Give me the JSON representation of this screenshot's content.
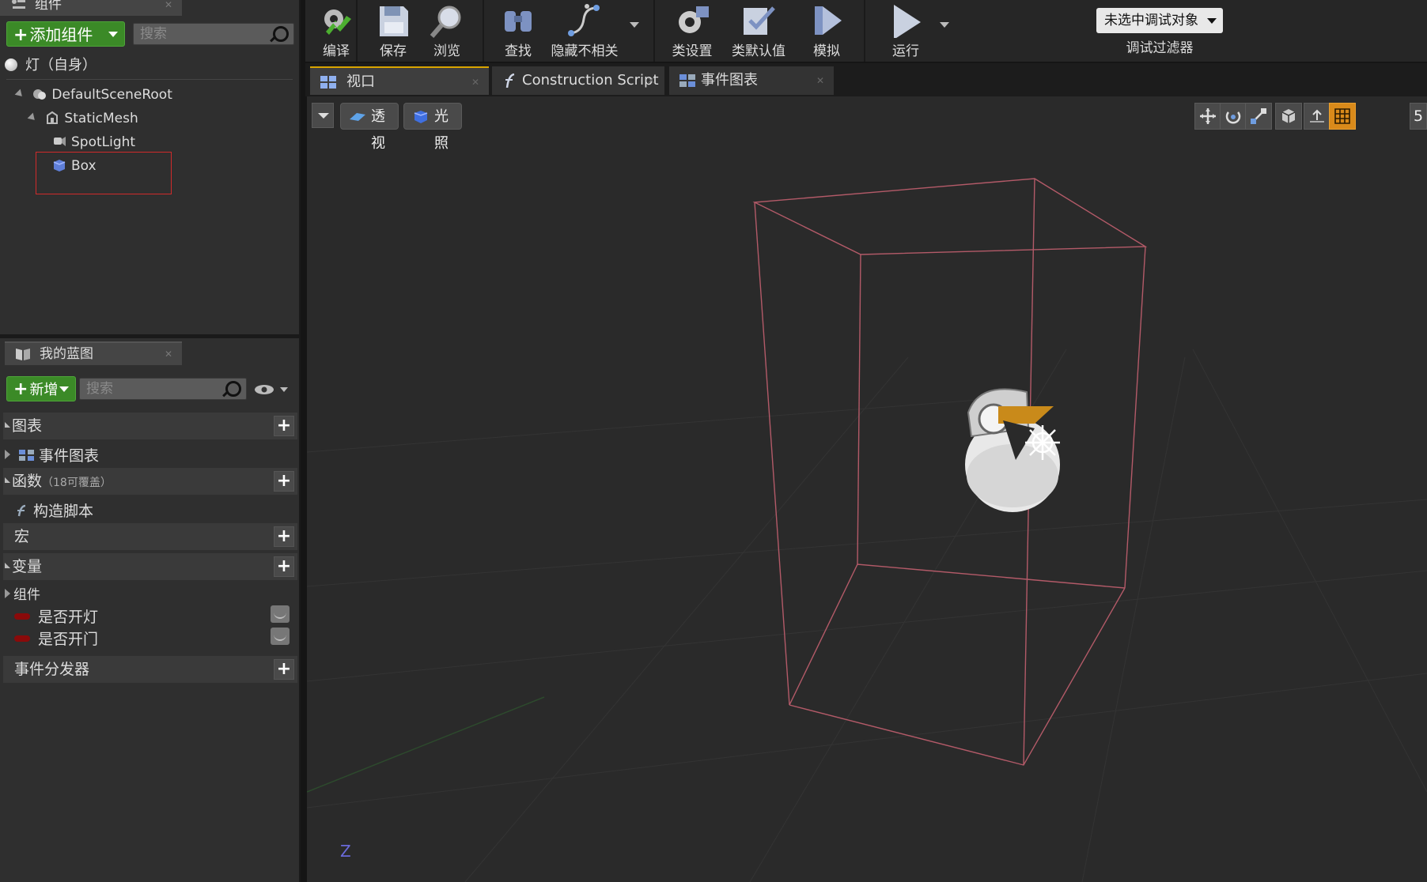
{
  "components_panel": {
    "tab_label": "组件",
    "add_button": "添加组件",
    "search_placeholder": "搜索",
    "self_item": "灯（自身）",
    "tree": [
      {
        "label": "DefaultSceneRoot",
        "icon": "scene-root-icon"
      },
      {
        "label": "StaticMesh",
        "icon": "static-mesh-icon"
      },
      {
        "label": "SpotLight",
        "icon": "spotlight-icon"
      },
      {
        "label": "Box",
        "icon": "box-icon"
      }
    ],
    "highlight_color": "#d02a2a"
  },
  "my_blueprint": {
    "tab_label": "我的蓝图",
    "new_button": "新增",
    "search_placeholder": "搜索",
    "sections": {
      "graphs": "图表",
      "event_graph": "事件图表",
      "functions": "函数",
      "functions_note": "（18可覆盖）",
      "construction_script": "构造脚本",
      "macros": "宏",
      "variables": "变量",
      "components": "组件",
      "var1": "是否开灯",
      "var2": "是否开门",
      "event_dispatchers": "事件分发器"
    },
    "variable_color": "#8a0a0a"
  },
  "toolbar": {
    "compile": "编译",
    "save": "保存",
    "browse": "浏览",
    "find": "查找",
    "hide_unrelated": "隐藏不相关",
    "class_settings": "类设置",
    "class_defaults": "类默认值",
    "simulate": "模拟",
    "play": "运行",
    "debug_object": "未选中调试对象",
    "debug_filter": "调试过滤器"
  },
  "doc_tabs": [
    {
      "label": "视口",
      "icon": "viewport-icon",
      "active": true
    },
    {
      "label": "Construction Script",
      "icon": "function-icon",
      "active": false
    },
    {
      "label": "事件图表",
      "icon": "event-graph-icon",
      "active": false
    }
  ],
  "viewport": {
    "perspective": "透视",
    "lit": "光照",
    "grid_size": "5",
    "axis_label": "Z",
    "accent": "#d9a400"
  }
}
